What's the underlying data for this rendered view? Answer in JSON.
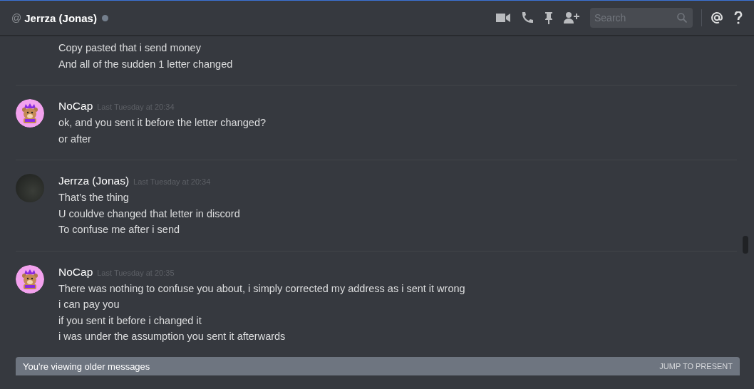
{
  "header": {
    "prefix": "@",
    "title": "Jerrza (Jonas)",
    "online": false,
    "search": {
      "placeholder": "Search"
    }
  },
  "messages": [
    {
      "lines": [
        "Copy pasted that i send money",
        "And all of the sudden 1 letter changed"
      ]
    },
    {
      "kind": "bear",
      "author": "NoCap",
      "timestamp": "Last Tuesday at 20:34",
      "lines": [
        "ok, and you sent it before the letter changed?",
        "or after"
      ]
    },
    {
      "kind": "photo",
      "author": "Jerrza (Jonas)",
      "timestamp": "Last Tuesday at 20:34",
      "lines": [
        "That’s the thing",
        "U couldve changed that letter in discord",
        "To confuse me after i send"
      ]
    },
    {
      "kind": "bear",
      "author": "NoCap",
      "timestamp": "Last Tuesday at 20:35",
      "lines": [
        "There was nothing to confuse you about, i simply corrected my address as i sent it wrong",
        "i can pay you",
        "if you sent it before i changed it",
        "i was under the assumption you sent it afterwards"
      ]
    }
  ],
  "older_bar": {
    "text": "You're viewing older messages",
    "action": "JUMP TO PRESENT"
  }
}
